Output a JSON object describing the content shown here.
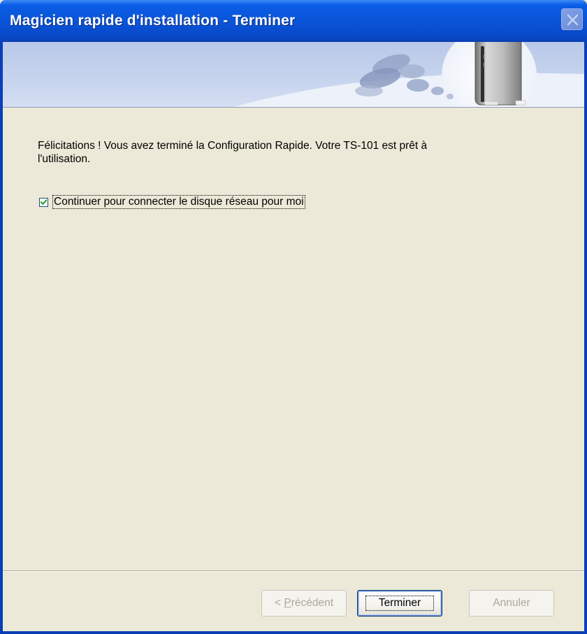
{
  "window": {
    "title": "Magicien rapide d'installation - Terminer"
  },
  "content": {
    "message_line1": "Félicitations ! Vous avez terminé la Configuration Rapide. Votre TS-101 est prêt à",
    "message_line2": "l'utilisation.",
    "checkbox_label": "Continuer pour connecter le disque réseau pour moi",
    "checkbox_checked": true
  },
  "buttons": {
    "back_prefix": "< ",
    "back_accel": "P",
    "back_rest": "récédent",
    "finish": "Terminer",
    "cancel": "Annuler"
  },
  "icons": {
    "close": "close-icon",
    "banner": "nas-device-image"
  },
  "colors": {
    "titlebar": "#0a54d8",
    "background": "#ece9d8",
    "banner": "#c7d4ee"
  }
}
